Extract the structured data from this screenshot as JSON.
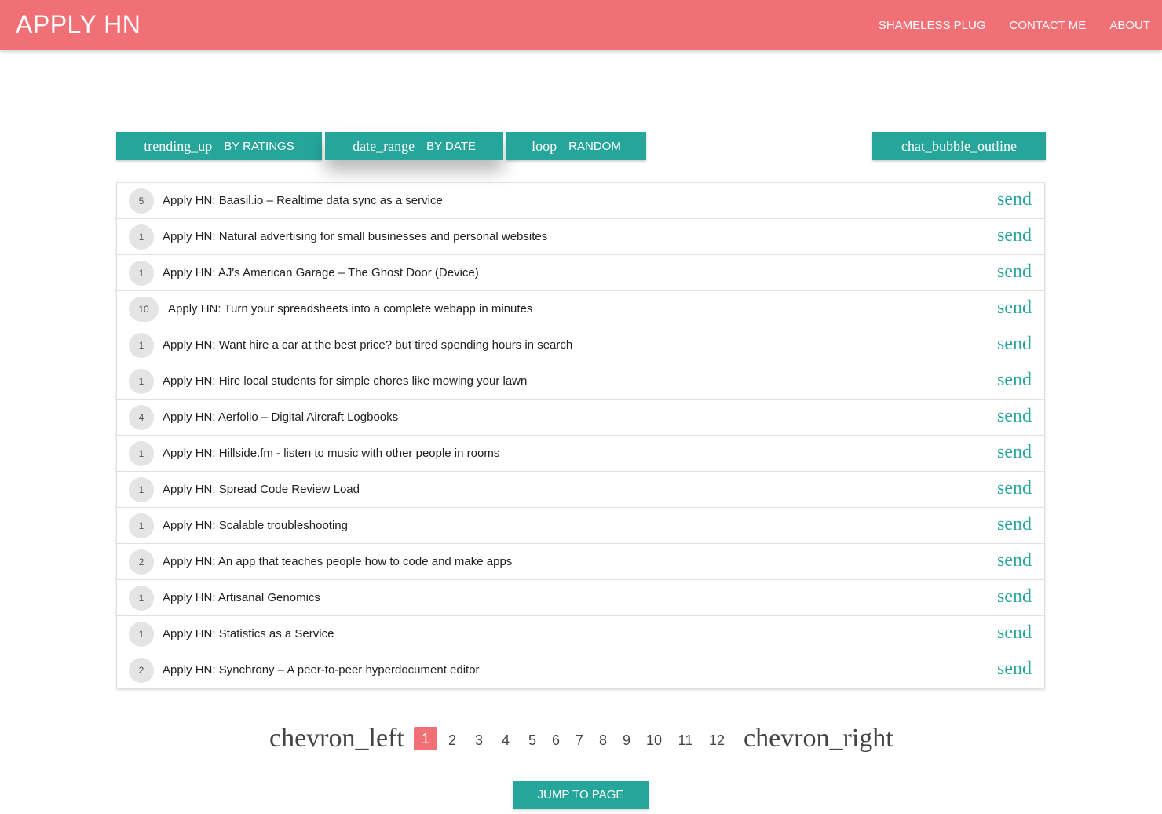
{
  "navbar": {
    "brand": "APPLY HN",
    "links": [
      "SHAMELESS PLUG",
      "CONTACT ME",
      "ABOUT"
    ]
  },
  "toolbar": {
    "ratings": {
      "icon": "trending_up",
      "label": "BY RATINGS"
    },
    "date": {
      "icon": "date_range",
      "label": "BY DATE"
    },
    "random": {
      "icon": "loop",
      "label": "RANDOM"
    },
    "chat": {
      "icon": "chat_bubble_outline"
    }
  },
  "items": [
    {
      "score": "5",
      "title": "Apply HN: Baasil.io – Realtime data sync as a service",
      "action": "send"
    },
    {
      "score": "1",
      "title": "Apply HN: Natural advertising for small businesses and personal websites",
      "action": "send"
    },
    {
      "score": "1",
      "title": "Apply HN: AJ's American Garage – The Ghost Door (Device)",
      "action": "send"
    },
    {
      "score": "10",
      "title": "Apply HN: Turn your spreadsheets into a complete webapp in minutes",
      "action": "send"
    },
    {
      "score": "1",
      "title": "Apply HN: Want hire a car at the best price? but tired spending hours in search",
      "action": "send"
    },
    {
      "score": "1",
      "title": "Apply HN: Hire local students for simple chores like mowing your lawn",
      "action": "send"
    },
    {
      "score": "4",
      "title": "Apply HN: Aerfolio – Digital Aircraft Logbooks",
      "action": "send"
    },
    {
      "score": "1",
      "title": "Apply HN: Hillside.fm - listen to music with other people in rooms",
      "action": "send"
    },
    {
      "score": "1",
      "title": "Apply HN: Spread Code Review Load",
      "action": "send"
    },
    {
      "score": "1",
      "title": "Apply HN: Scalable troubleshooting",
      "action": "send"
    },
    {
      "score": "2",
      "title": "Apply HN: An app that teaches people how to code and make apps",
      "action": "send"
    },
    {
      "score": "1",
      "title": "Apply HN: Artisanal Genomics",
      "action": "send"
    },
    {
      "score": "1",
      "title": "Apply HN: Statistics as a Service",
      "action": "send"
    },
    {
      "score": "2",
      "title": "Apply HN: Synchrony – A peer-to-peer hyperdocument editor",
      "action": "send"
    }
  ],
  "pagination": {
    "prev_icon": "chevron_left",
    "next_icon": "chevron_right",
    "pages": [
      "1",
      "2",
      "3",
      "4",
      "5",
      "6",
      "7",
      "8",
      "9",
      "10",
      "11",
      "12"
    ],
    "current": "1"
  },
  "jump_label": "JUMP TO PAGE",
  "colors": {
    "primary": "#f07075",
    "accent": "#26a69a"
  }
}
